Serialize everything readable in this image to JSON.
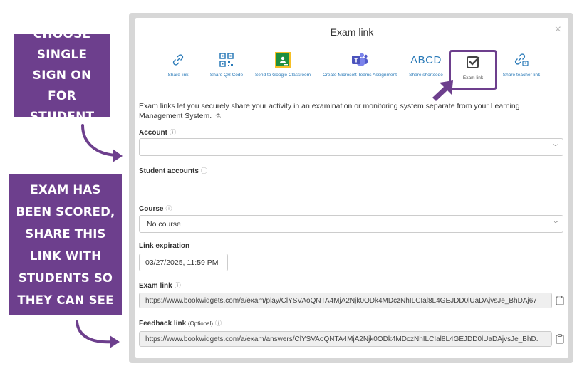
{
  "callouts": {
    "first": "Choose single sign on for student",
    "second": "After the exam has been scored, share this link with students so they can see the feedback"
  },
  "modal": {
    "title": "Exam link",
    "close": "×"
  },
  "tabs": [
    {
      "label": "Share link",
      "icon": "link-icon"
    },
    {
      "label": "Share QR Code",
      "icon": "qr-code-icon"
    },
    {
      "label": "Send to Google Classroom",
      "icon": "google-classroom-icon"
    },
    {
      "label": "Create Microsoft Teams Assignment",
      "icon": "microsoft-teams-icon"
    },
    {
      "label": "Share shortcode",
      "icon": "abcd-icon",
      "icon_text": "ABCD"
    },
    {
      "label": "Exam link",
      "icon": "checkbox-icon",
      "active": true
    },
    {
      "label": "Share teacher link",
      "icon": "teacher-link-icon"
    }
  ],
  "description": "Exam links let you securely share your activity in an examination or monitoring system separate from your Learning Management System.",
  "fields": {
    "account_label": "Account",
    "account_value": "",
    "student_accounts_label": "Student accounts",
    "course_label": "Course",
    "course_value": "No course",
    "expiration_label": "Link expiration",
    "expiration_value": "03/27/2025, 11:59 PM",
    "exam_link_label": "Exam link",
    "exam_link_value": "https://www.bookwidgets.com/a/exam/play/ClYSVAoQNTA4MjA2Njk0ODk4MDczNhILCIal8L4GEJDD0lUaDAjvsJe_BhDAj67",
    "feedback_link_label": "Feedback link",
    "feedback_link_optional": "(Optional)",
    "feedback_link_value": "https://www.bookwidgets.com/a/exam/answers/ClYSVAoQNTA4MjA2Njk0ODk4MDczNhILCIal8L4GEJDD0lUaDAjvsJe_BhD."
  },
  "colors": {
    "accent_purple": "#6d3f8d",
    "link_blue": "#2a7ab8",
    "google_green": "#1e8e3e",
    "teams_purple": "#5b5fc7"
  }
}
